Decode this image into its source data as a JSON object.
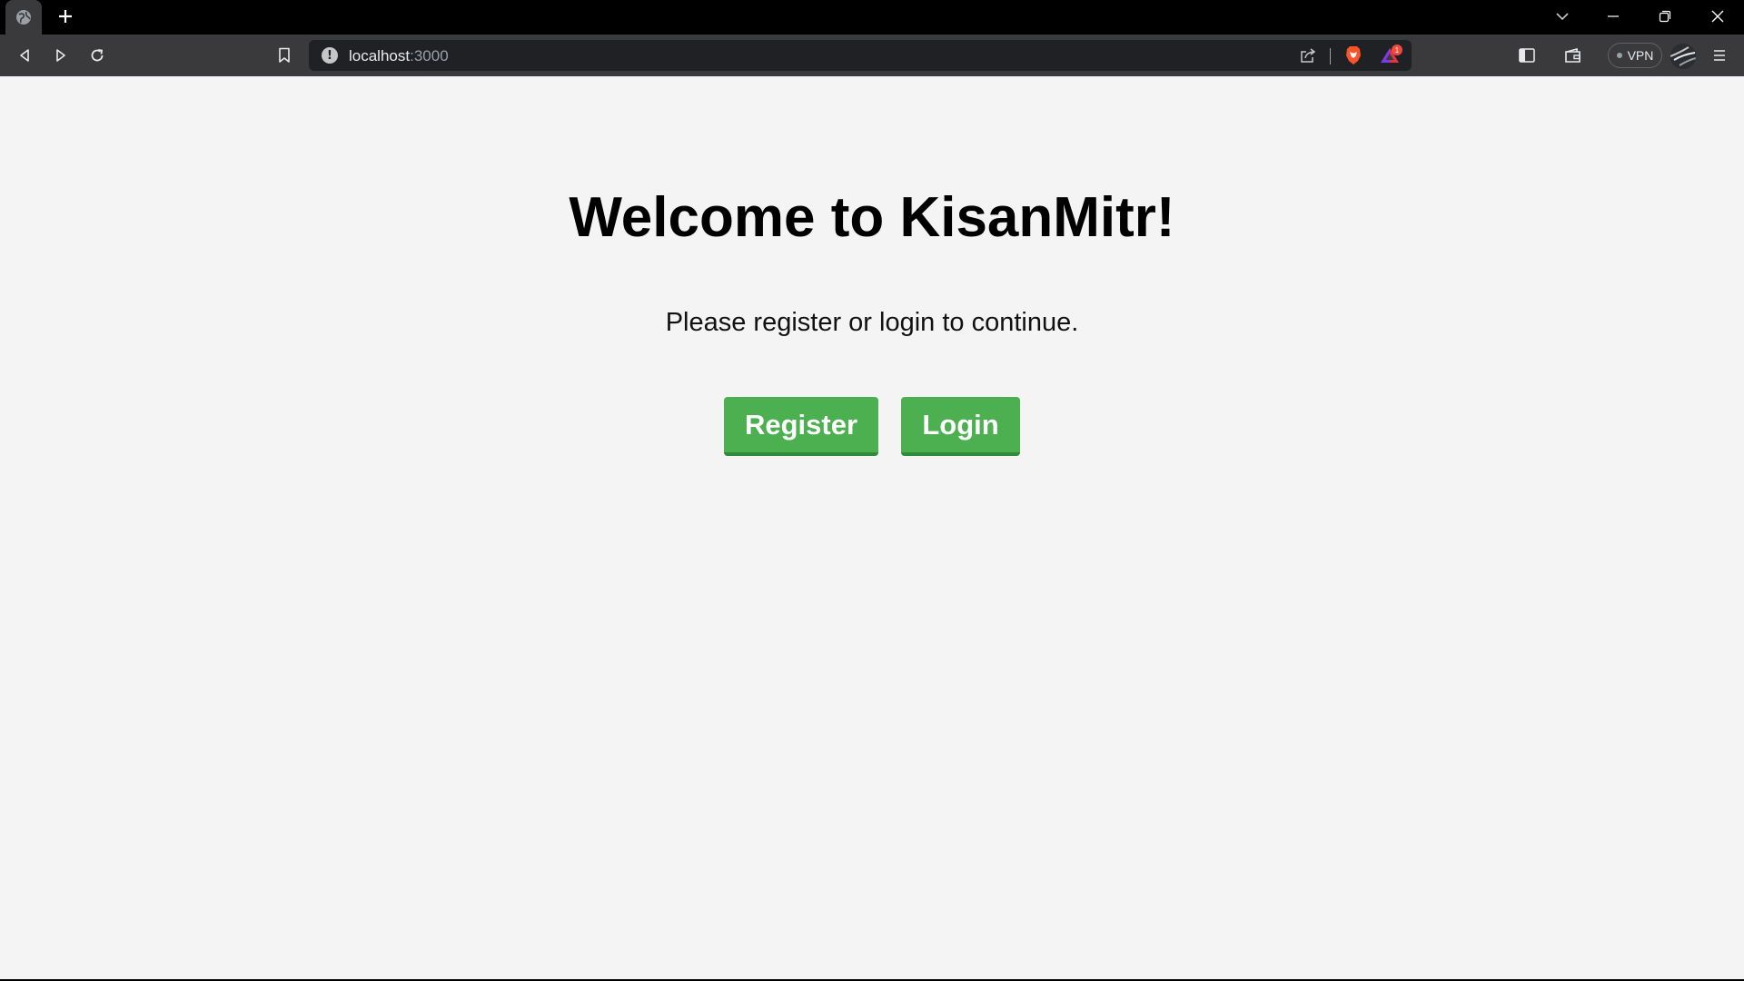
{
  "browser": {
    "url_host": "localhost",
    "url_port": ":3000",
    "vpn_label": "VPN",
    "rewards_badge_count": "1",
    "icons": {
      "tab_favicon": "globe-icon",
      "new_tab": "plus-icon",
      "tab_search": "chevron-down-icon",
      "minimize": "minimize-icon",
      "restore": "restore-icon",
      "close": "close-icon",
      "back": "back-arrow-icon",
      "forward": "forward-arrow-icon",
      "reload": "reload-icon",
      "bookmark": "bookmark-icon",
      "site_info": "info-icon",
      "share": "share-icon",
      "brave_shields": "brave-lion-icon",
      "brave_rewards": "rewards-triangle-icon",
      "sidebar": "sidebar-icon",
      "wallet": "wallet-icon",
      "menu": "hamburger-menu-icon"
    },
    "colors": {
      "tabstrip_bg": "#000000",
      "toolbar_bg": "#3a3a3c",
      "omnibox_bg": "#202124",
      "brave_orange": "#fb542b"
    }
  },
  "page": {
    "title": "Welcome to KisanMitr!",
    "subtitle": "Please register or login to continue.",
    "buttons": {
      "register_label": "Register",
      "login_label": "Login"
    },
    "colors": {
      "background": "#f4f4f4",
      "button_green": "#4caf50",
      "button_text": "#ffffff"
    }
  }
}
